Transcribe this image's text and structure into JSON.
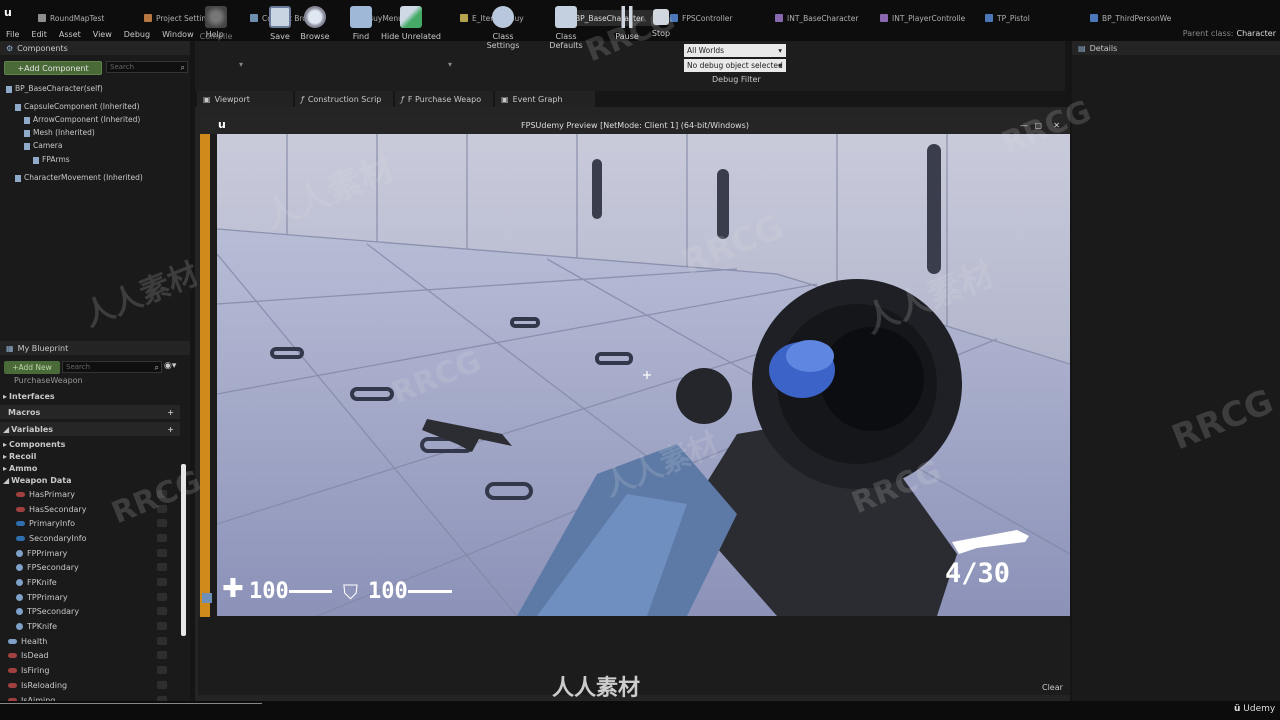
{
  "tabs": [
    {
      "label": "RoundMapTest",
      "color": "#8f8f8f"
    },
    {
      "label": "Project Settings",
      "color": "#b7763f"
    },
    {
      "label": "Content Browser",
      "color": "#6e8fb0"
    },
    {
      "label": "BuyMenu",
      "color": "#7a9f5b"
    },
    {
      "label": "E_ItemsToBuy",
      "color": "#b6a44f"
    },
    {
      "label": "BP_BaseCharacter",
      "color": "#4b78b8"
    },
    {
      "label": "FPSController",
      "color": "#4b78b8"
    },
    {
      "label": "INT_BaseCharacter",
      "color": "#8a68b0"
    },
    {
      "label": "INT_PlayerControlle",
      "color": "#8a68b0"
    },
    {
      "label": "TP_Pistol",
      "color": "#4b78b8"
    },
    {
      "label": "BP_ThirdPersonWe",
      "color": "#4b78b8"
    }
  ],
  "menu": [
    "File",
    "Edit",
    "Asset",
    "View",
    "Debug",
    "Window",
    "Help"
  ],
  "parent_class": {
    "label": "Parent class:",
    "value": "Character"
  },
  "components": {
    "title": "Components",
    "add_label": "+Add Component",
    "search_placeholder": "Search",
    "tree": [
      {
        "label": "BP_BaseCharacter(self)",
        "indent": 0
      },
      {
        "label": "CapsuleComponent (Inherited)",
        "indent": 1
      },
      {
        "label": "ArrowComponent (Inherited)",
        "indent": 2
      },
      {
        "label": "Mesh (Inherited)",
        "indent": 2
      },
      {
        "label": "Camera",
        "indent": 2
      },
      {
        "label": "FPArms",
        "indent": 3
      },
      {
        "label": "CharacterMovement (Inherited)",
        "indent": 1
      }
    ]
  },
  "my_blueprint": {
    "title": "My Blueprint",
    "add_label": "+Add New",
    "search_placeholder": "Search",
    "partial_item": "PurchaseWeapon",
    "sections": [
      "Interfaces",
      "Macros",
      "Variables"
    ],
    "categories": [
      "Components",
      "Recoil",
      "Ammo",
      "Weapon Data"
    ],
    "weapon_vars": [
      "HasPrimary",
      "HasSecondary",
      "PrimaryInfo",
      "SecondaryInfo",
      "FPPrimary",
      "FPSecondary",
      "FPKnife",
      "TPPrimary",
      "TPSecondary",
      "TPKnife"
    ],
    "root_vars": [
      "Health",
      "IsDead",
      "IsFiring",
      "IsReloading",
      "IsAiming"
    ]
  },
  "toolbar": {
    "compile": "Compile",
    "save": "Save",
    "browse": "Browse",
    "find": "Find",
    "hide_unrelated": "Hide Unrelated",
    "class_settings": "Class Settings",
    "class_defaults": "Class Defaults",
    "pause": "Pause",
    "stop": "Stop",
    "world": "All Worlds",
    "debug_object": "No debug object selected",
    "debug_filter": "Debug Filter"
  },
  "editor_tabs": [
    "Viewport",
    "Construction Scrip",
    "F Purchase Weapo",
    "Event Graph"
  ],
  "details_title": "Details",
  "game": {
    "title": "FPSUdemy Preview [NetMode: Client 1] (64-bit/Windows)",
    "health": "100",
    "armor": "100",
    "ammo": "4/30"
  },
  "console": {
    "clear": "Clear"
  },
  "watermarks": {
    "rrcg": "RRCG",
    "cn": "人人素材",
    "udemy": "Udemy"
  }
}
